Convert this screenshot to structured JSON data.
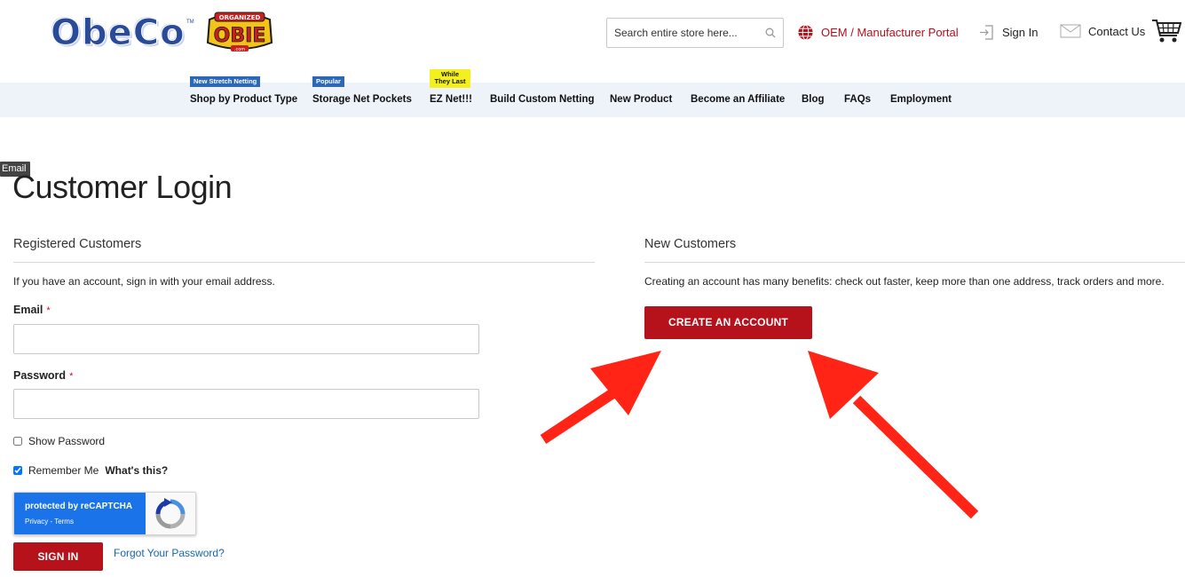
{
  "header": {
    "logo_text": "ObeCo",
    "logo_tm": "TM",
    "obie_logo_text": "OBIE",
    "obie_logo_top": "ORGANIZED",
    "obie_logo_bottom": ".com",
    "search_placeholder": "Search entire store here...",
    "oem_label": "OEM / Manufacturer Portal",
    "signin_label": "Sign In",
    "contact_label": "Contact Us",
    "accent_color": "#b5121b"
  },
  "nav": {
    "items": [
      {
        "label": "Shop by Product Type",
        "badge": "New Stretch Netting"
      },
      {
        "label": "Storage Net Pockets",
        "badge": "Popular"
      },
      {
        "label": "EZ Net!!!",
        "badge": "While They Last"
      },
      {
        "label": "Build Custom Netting"
      },
      {
        "label": "New Product"
      },
      {
        "label": "Become an Affiliate"
      },
      {
        "label": "Blog"
      },
      {
        "label": "FAQs"
      },
      {
        "label": "Employment"
      }
    ]
  },
  "tooltip": {
    "text": "Email"
  },
  "page": {
    "title": "Customer Login"
  },
  "registered": {
    "title": "Registered Customers",
    "description": "If you have an account, sign in with your email address.",
    "email_label": "Email",
    "password_label": "Password",
    "required_mark": "*",
    "show_password_label": "Show Password",
    "remember_label": "Remember Me",
    "whats_this_label": "What's this?",
    "recaptcha_text": "protected by reCAPTCHA",
    "recaptcha_links": "Privacy - Terms",
    "signin_button": "SIGN IN",
    "forgot_link": "Forgot Your Password?",
    "show_password_checked": false,
    "remember_checked": true
  },
  "new_customers": {
    "title": "New Customers",
    "description": "Creating an account has many benefits: check out faster, keep more than one address, track orders and more.",
    "create_button": "CREATE AN ACCOUNT"
  },
  "annotation": {
    "arrow_color": "#ff2416"
  }
}
